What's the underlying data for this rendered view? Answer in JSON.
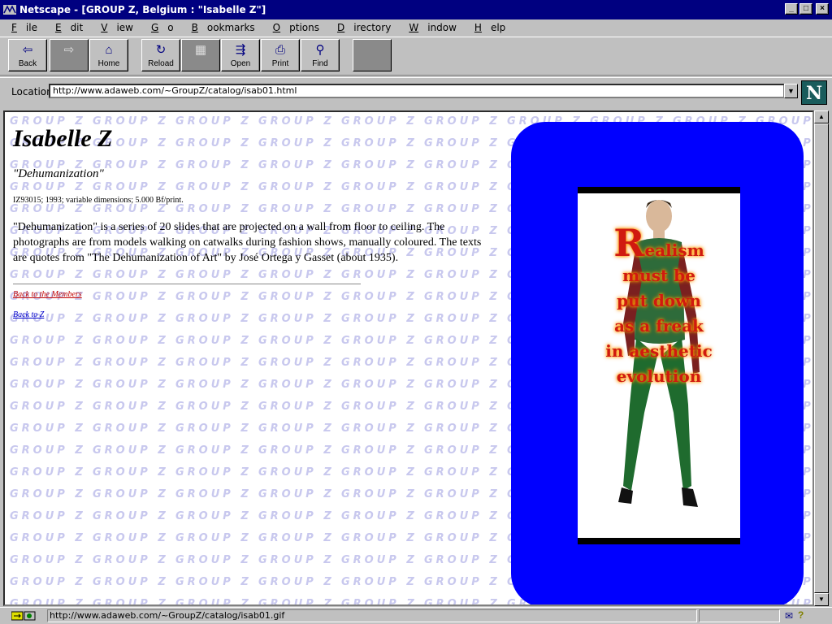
{
  "window": {
    "title": "Netscape - [GROUP Z, Belgium : \"Isabelle Z\"]",
    "min_glyph": "_",
    "max_glyph": "□",
    "close_glyph": "×"
  },
  "menu": [
    {
      "label": "File",
      "underline": "F"
    },
    {
      "label": "Edit",
      "underline": "E"
    },
    {
      "label": "View",
      "underline": "V"
    },
    {
      "label": "Go",
      "underline": "G"
    },
    {
      "label": "Bookmarks",
      "underline": "B"
    },
    {
      "label": "Options",
      "underline": "O"
    },
    {
      "label": "Directory",
      "underline": "D"
    },
    {
      "label": "Window",
      "underline": "W"
    },
    {
      "label": "Help",
      "underline": "H"
    }
  ],
  "toolbar": {
    "back": "Back",
    "home": "Home",
    "reload": "Reload",
    "open": "Open",
    "print": "Print",
    "find": "Find"
  },
  "location": {
    "label": "Location:",
    "url": "http://www.adaweb.com/~GroupZ/catalog/isab01.html"
  },
  "page": {
    "title": "Isabelle Z",
    "work_title": "\"Dehumanization\"",
    "meta": "IZ93015; 1993; variable dimensions; 5.000 Bf/print.",
    "description": "\"Dehumanization\" is a series of 20 slides that are projected on a wall from floor to ceiling. The photographs are from models walking on catwalks during fashion shows, manually coloured. The texts are quotes from \"The Dehumanization of Art\" by José Ortega y Gasset (about 1935).",
    "link_members": "Back to the Members",
    "link_z": "Back to Z",
    "watermark": "GROUP Z",
    "artwork": {
      "first_letter": "R",
      "line1": "ealism",
      "line2": "must be",
      "line3": "put down",
      "line4": "as a freak",
      "line5": "in aesthetic",
      "line6": "evolution"
    }
  },
  "status": {
    "text": "http://www.adaweb.com/~GroupZ/catalog/isab01.gif"
  },
  "colors": {
    "titlebar": "#000080",
    "art_frame": "#0000ff",
    "link_visited": "#c00000",
    "link": "#0000cc"
  }
}
